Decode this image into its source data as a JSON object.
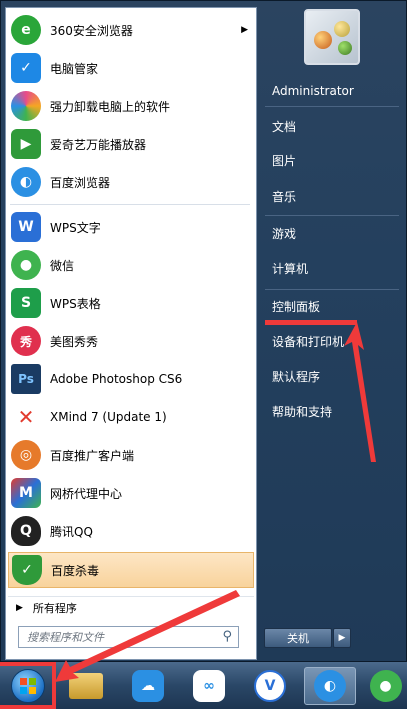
{
  "programs": [
    {
      "label": "360安全浏览器",
      "icon": "360-browser-icon",
      "has_submenu": true,
      "color": "#2aa639",
      "glyph": "e"
    },
    {
      "label": "电脑管家",
      "icon": "pc-manager-icon",
      "has_submenu": false,
      "color": "#1e88e5",
      "glyph": "✓"
    },
    {
      "label": "强力卸载电脑上的软件",
      "icon": "uninstaller-icon",
      "has_submenu": false,
      "color": "#e84b8a",
      "glyph": "✿"
    },
    {
      "label": "爱奇艺万能播放器",
      "icon": "iqiyi-player-icon",
      "has_submenu": false,
      "color": "#2f9a3a",
      "glyph": "▶"
    },
    {
      "label": "百度浏览器",
      "icon": "baidu-browser-icon",
      "has_submenu": false,
      "color": "#2b90e3",
      "glyph": "◐"
    },
    {
      "label": "WPS文字",
      "icon": "wps-writer-icon",
      "has_submenu": false,
      "color": "#2a6fd6",
      "glyph": "W"
    },
    {
      "label": "微信",
      "icon": "wechat-icon",
      "has_submenu": false,
      "color": "#3fb34f",
      "glyph": "●"
    },
    {
      "label": "WPS表格",
      "icon": "wps-spreadsheet-icon",
      "has_submenu": false,
      "color": "#1e9e4a",
      "glyph": "S"
    },
    {
      "label": "美图秀秀",
      "icon": "meitu-icon",
      "has_submenu": false,
      "color": "#e0304e",
      "glyph": "秀"
    },
    {
      "label": "Adobe Photoshop CS6",
      "icon": "photoshop-icon",
      "has_submenu": false,
      "color": "#1a3b63",
      "glyph": "Ps"
    },
    {
      "label": "XMind 7 (Update 1)",
      "icon": "xmind-icon",
      "has_submenu": false,
      "color": "#e23b2e",
      "glyph": "✕"
    },
    {
      "label": "百度推广客户端",
      "icon": "baidu-promotion-icon",
      "has_submenu": false,
      "color": "#e67a2b",
      "glyph": "◎"
    },
    {
      "label": "网桥代理中心",
      "icon": "bridge-proxy-icon",
      "has_submenu": false,
      "color": "#6a8fc4",
      "glyph": "M"
    },
    {
      "label": "腾讯QQ",
      "icon": "qq-icon",
      "has_submenu": false,
      "color": "#222222",
      "glyph": "Q"
    },
    {
      "label": "百度杀毒",
      "icon": "baidu-antivirus-icon",
      "has_submenu": false,
      "color": "#2f9a3a",
      "glyph": "✓"
    }
  ],
  "all_programs_label": "所有程序",
  "search": {
    "placeholder": "搜索程序和文件"
  },
  "user": {
    "name": "Administrator"
  },
  "right_items": [
    {
      "label": "文档"
    },
    {
      "label": "图片"
    },
    {
      "label": "音乐"
    },
    {
      "label": "游戏"
    },
    {
      "label": "计算机"
    },
    {
      "label": "控制面板"
    },
    {
      "label": "设备和打印机"
    },
    {
      "label": "默认程序"
    },
    {
      "label": "帮助和支持"
    }
  ],
  "shutdown_label": "关机",
  "taskbar": [
    {
      "icon": "windows-start-icon"
    },
    {
      "icon": "file-explorer-icon"
    },
    {
      "icon": "baidu-cloud-icon"
    },
    {
      "icon": "baidu-netdisk-icon"
    },
    {
      "icon": "v-app-icon"
    },
    {
      "icon": "baidu-browser-taskbar-icon"
    },
    {
      "icon": "wechat-taskbar-icon"
    }
  ],
  "colors": {
    "highlight": "#f8d39c",
    "annotation_red": "#ef3a3a",
    "menu_blue": "#24405e"
  }
}
